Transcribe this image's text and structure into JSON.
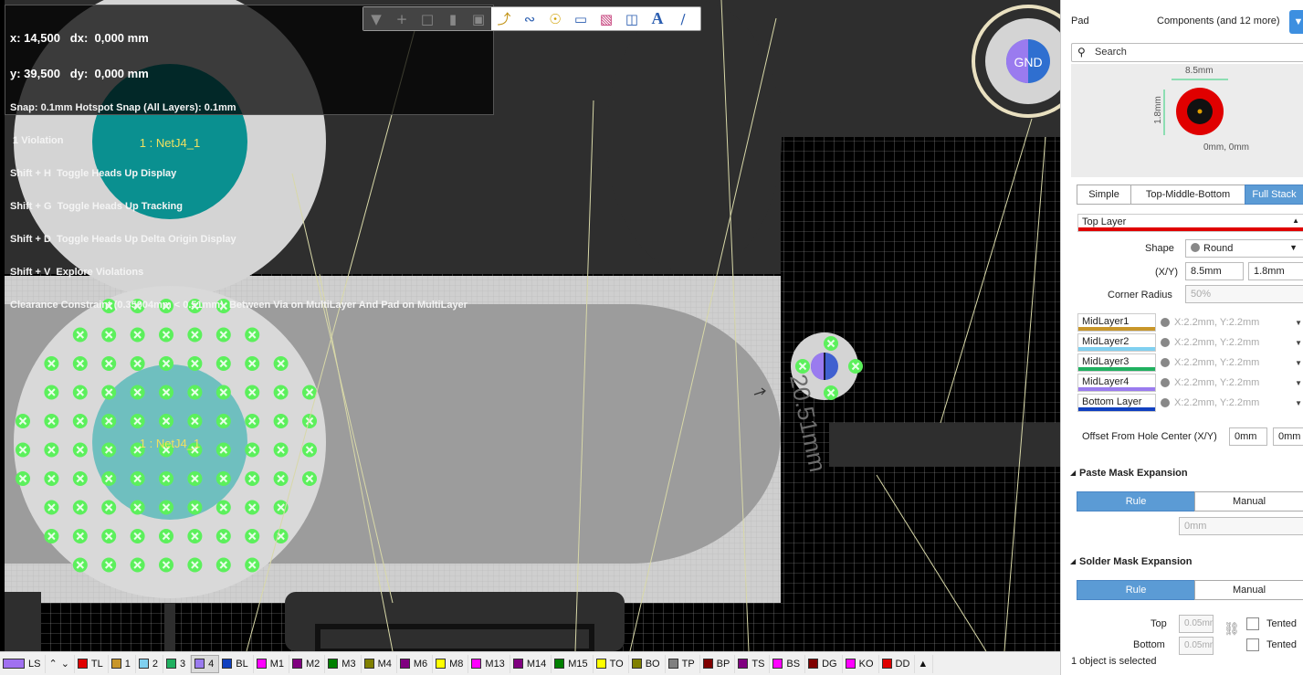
{
  "hud": {
    "coords_x": "x: 14,500   dx:  0,000 mm",
    "coords_y": "y: 39,500   dy:  0,000 mm",
    "snap": "Snap: 0.1mm Hotspot Snap (All Layers): 0.1mm",
    "violations": " 1 Violation",
    "shortcut1": "Shift + H  Toggle Heads Up Display",
    "shortcut2": "Shift + G  Toggle Heads Up Tracking",
    "shortcut3": "Shift + D  Toggle Heads Up Delta Origin Display",
    "shortcut4": "Shift + V  Explore Violations",
    "clearance": "Clearance Constraint (0.35004mm < 0.51mm)  Between Via on MultiLayer And Pad on MultiLayer"
  },
  "canvas": {
    "pad_top_label": "1 : NetJ4_1",
    "pad_bottom_label": "1 : NetJ4_1",
    "gnd_label": "GND",
    "dimension_text": "20.51mm"
  },
  "toolbar": {
    "icons": [
      "filter-icon",
      "plus-icon",
      "rect-select-icon",
      "chart-icon",
      "chip-icon",
      "route-icon",
      "meander-icon",
      "via-icon",
      "polygon-icon",
      "keepout-icon",
      "dimension-icon",
      "text-icon",
      "line-icon"
    ]
  },
  "layers": [
    {
      "label": "LS",
      "color": "#a070f0",
      "active": false
    },
    {
      "label": "TL",
      "color": "#e00000",
      "active": false
    },
    {
      "label": "1",
      "color": "#c8962a",
      "active": false
    },
    {
      "label": "2",
      "color": "#80d0f0",
      "active": false
    },
    {
      "label": "3",
      "color": "#20b060",
      "active": false
    },
    {
      "label": "4",
      "color": "#9a7bef",
      "active": true
    },
    {
      "label": "BL",
      "color": "#1040c0",
      "active": false
    },
    {
      "label": "M1",
      "color": "#ff00ff",
      "active": false
    },
    {
      "label": "M2",
      "color": "#800080",
      "active": false
    },
    {
      "label": "M3",
      "color": "#008000",
      "active": false
    },
    {
      "label": "M4",
      "color": "#808000",
      "active": false
    },
    {
      "label": "M6",
      "color": "#800080",
      "active": false
    },
    {
      "label": "M8",
      "color": "#ffff00",
      "active": false
    },
    {
      "label": "M13",
      "color": "#ff00ff",
      "active": false
    },
    {
      "label": "M14",
      "color": "#800080",
      "active": false
    },
    {
      "label": "M15",
      "color": "#008000",
      "active": false
    },
    {
      "label": "TO",
      "color": "#ffff00",
      "active": false
    },
    {
      "label": "BO",
      "color": "#808000",
      "active": false
    },
    {
      "label": "TP",
      "color": "#808080",
      "active": false
    },
    {
      "label": "BP",
      "color": "#800000",
      "active": false
    },
    {
      "label": "TS",
      "color": "#800080",
      "active": false
    },
    {
      "label": "BS",
      "color": "#ff00ff",
      "active": false
    },
    {
      "label": "DG",
      "color": "#800000",
      "active": false
    },
    {
      "label": "KO",
      "color": "#ff00ff",
      "active": false
    },
    {
      "label": "DD",
      "color": "#e00000",
      "active": false
    }
  ],
  "panel": {
    "title": "Pad",
    "filter_label": "Components (and 12 more)",
    "search_placeholder": "Search",
    "preview": {
      "width_label": "8.5mm",
      "height_label": "1.8mm",
      "origin_label": "0mm, 0mm"
    },
    "tabs": [
      "Simple",
      "Top-Middle-Bottom",
      "Full Stack"
    ],
    "active_tab": "Full Stack",
    "top_layer": {
      "name": "Top Layer",
      "color": "#e00000",
      "shape_label": "Shape",
      "shape_value": "Round",
      "xy_label": "(X/Y)",
      "x_value": "8.5mm",
      "y_value": "1.8mm",
      "corner_label": "Corner Radius",
      "corner_value": "50%"
    },
    "mid_layers": [
      {
        "name": "MidLayer1",
        "color": "#c8962a",
        "value": "X:2.2mm, Y:2.2mm"
      },
      {
        "name": "MidLayer2",
        "color": "#80d0f0",
        "value": "X:2.2mm, Y:2.2mm"
      },
      {
        "name": "MidLayer3",
        "color": "#20b060",
        "value": "X:2.2mm, Y:2.2mm"
      },
      {
        "name": "MidLayer4",
        "color": "#9a7bef",
        "value": "X:2.2mm, Y:2.2mm"
      },
      {
        "name": "Bottom Layer",
        "color": "#1040c0",
        "value": "X:2.2mm, Y:2.2mm"
      }
    ],
    "offset_label": "Offset From Hole Center (X/Y)",
    "offset_x": "0mm",
    "offset_y": "0mm",
    "paste": {
      "title": "Paste Mask Expansion",
      "rule": "Rule",
      "manual": "Manual",
      "value": "0mm"
    },
    "solder": {
      "title": "Solder Mask Expansion",
      "rule": "Rule",
      "manual": "Manual",
      "top_label": "Top",
      "top_value": "0.05mm",
      "bottom_label": "Bottom",
      "bottom_value": "0.05mm",
      "tented": "Tented"
    },
    "status": "1 object is selected"
  }
}
